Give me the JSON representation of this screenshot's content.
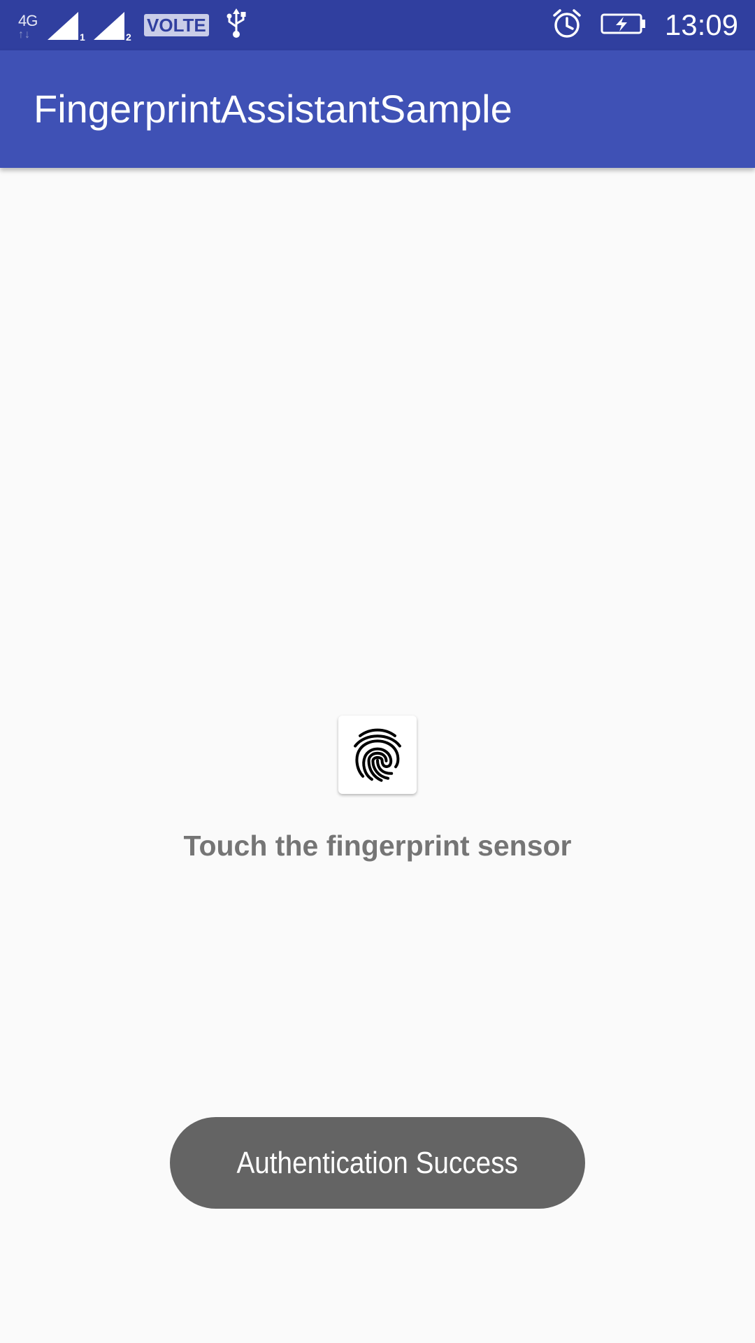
{
  "status_bar": {
    "network_type": "4G",
    "network_arrows": "↑↓",
    "sim1_label": "1",
    "sim2_label": "2",
    "volte_label": "VOLTE",
    "time": "13:09",
    "icons": [
      "signal-icon",
      "usb-icon",
      "alarm-icon",
      "battery-charging-icon"
    ]
  },
  "app_bar": {
    "title": "FingerprintAssistantSample"
  },
  "main": {
    "fingerprint_icon": "fingerprint-icon",
    "instruction": "Touch the fingerprint sensor"
  },
  "toast": {
    "message": "Authentication Success"
  },
  "colors": {
    "status_bar": "#303f9f",
    "app_bar": "#3f51b5",
    "background": "#fafafa",
    "instruction_text": "#757575",
    "toast_bg": "#646464"
  }
}
